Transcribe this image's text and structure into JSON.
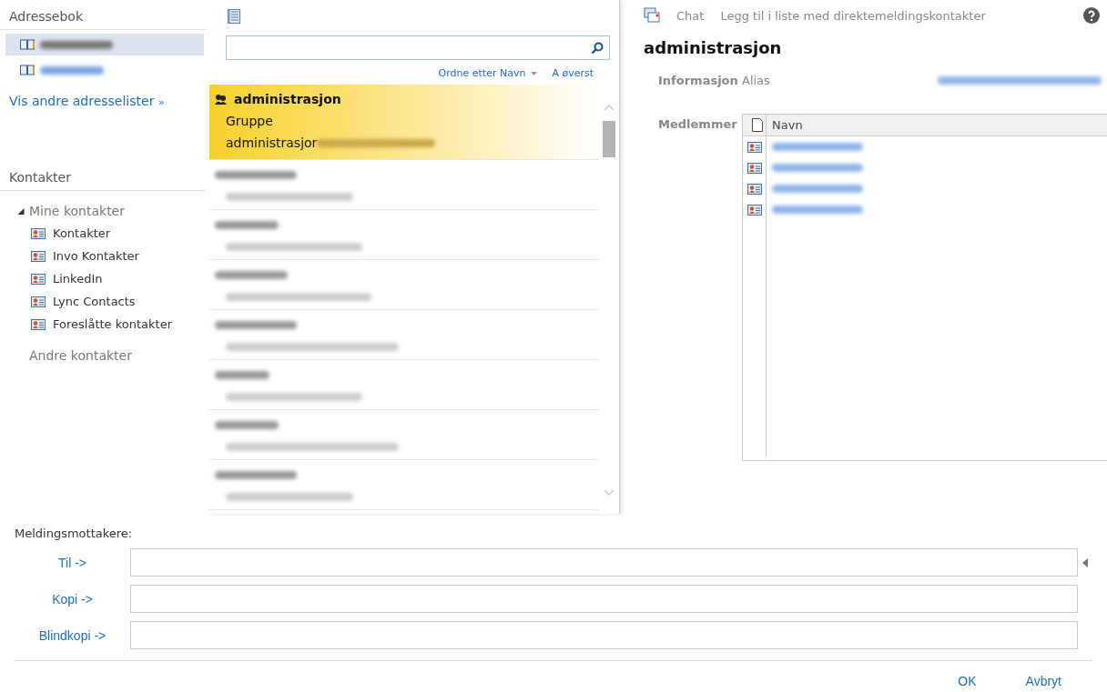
{
  "address_book": {
    "title": "Adressebok",
    "lists": [
      {
        "kind": "redacted",
        "selected": true
      },
      {
        "kind": "redacted",
        "selected": false
      }
    ],
    "more_link": "Vis andre adresselister",
    "more_icon": "»"
  },
  "contacts_section": {
    "title": "Kontakter",
    "tree": [
      {
        "label": "Mine kontakter",
        "expanded": true,
        "children": [
          {
            "label": "Kontakter"
          },
          {
            "label": "Invo Kontakter"
          },
          {
            "label": "LinkedIn"
          },
          {
            "label": "Lync Contacts"
          },
          {
            "label": "Foreslåtte kontakter"
          }
        ]
      },
      {
        "label": "Andre kontakter"
      }
    ]
  },
  "sort": {
    "label": "Ordne etter Navn",
    "order": "A øverst"
  },
  "contacts": [
    {
      "kind": "group",
      "selected": true,
      "name": "administrasjon",
      "type": "Gruppe",
      "email": "administrasjor"
    },
    {
      "kind": "redacted",
      "selected": false
    },
    {
      "kind": "redacted",
      "selected": false
    },
    {
      "kind": "redacted",
      "selected": false
    },
    {
      "kind": "redacted",
      "selected": false
    },
    {
      "kind": "redacted",
      "selected": false
    },
    {
      "kind": "redacted",
      "selected": false
    },
    {
      "kind": "redacted",
      "selected": false
    }
  ],
  "details": {
    "actions": [
      "Chat",
      "Legg til i liste med direktemeldingskontakter"
    ],
    "name": "administrasjon",
    "info_label": "Informasjon",
    "alias_label": "Alias",
    "members_label": "Medlemmer",
    "members_column": "Navn",
    "members": [
      {
        "kind": "redacted"
      },
      {
        "kind": "redacted"
      },
      {
        "kind": "redacted"
      },
      {
        "kind": "redacted"
      }
    ]
  },
  "recipients": {
    "title": "Meldingsmottakere:",
    "fields": [
      {
        "label": "Til ->"
      },
      {
        "label": "Kopi ->"
      },
      {
        "label": "Blindkopi ->"
      }
    ]
  },
  "buttons": [
    "OK",
    "Avbryt"
  ]
}
